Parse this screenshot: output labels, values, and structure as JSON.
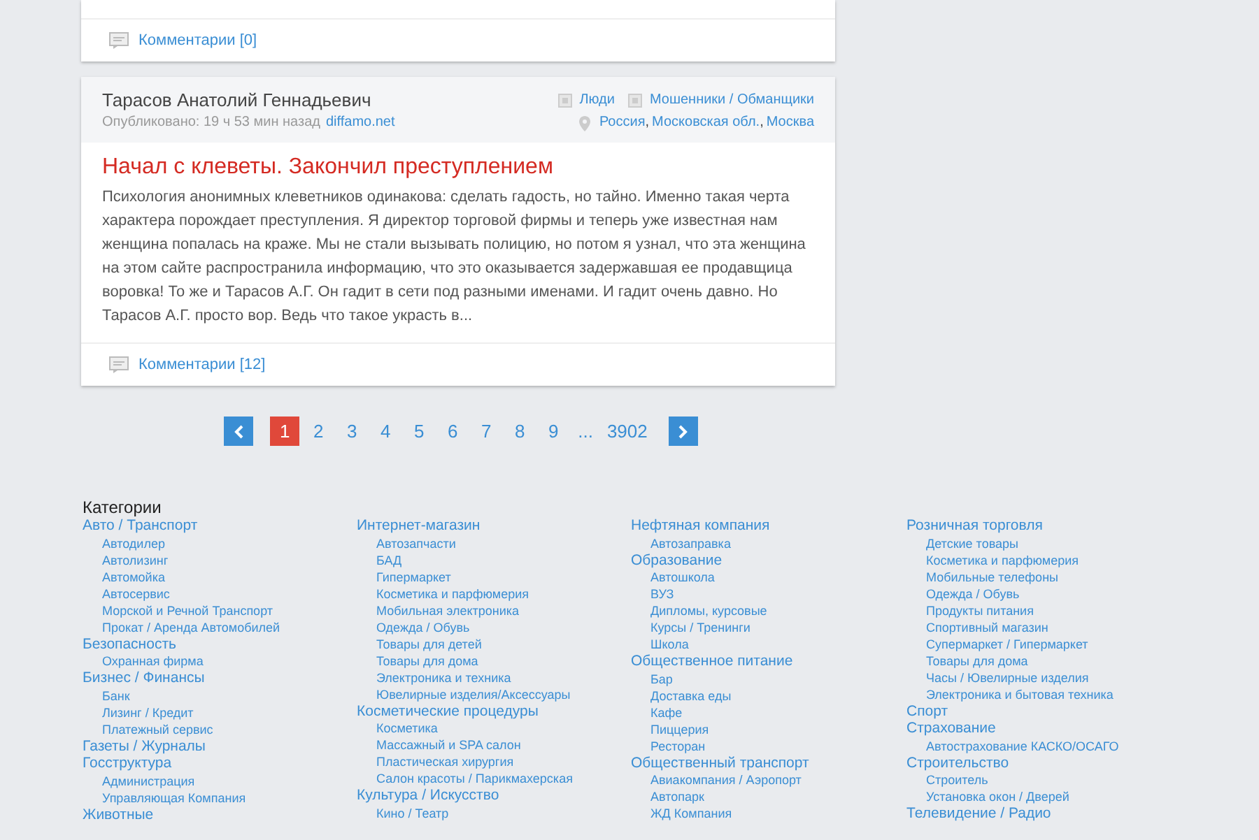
{
  "first_post": {
    "comments": "Комментарии [0]"
  },
  "post": {
    "author": "Тарасов Анатолий Геннадьевич",
    "published": "Опубликовано: 19 ч 53 мин назад",
    "source": "diffamo.net",
    "tags": [
      "Люди",
      "Мошенники / Обманщики"
    ],
    "location": [
      {
        "name": "Россия",
        "sep": ","
      },
      {
        "name": "Московская обл.",
        "sep": ","
      },
      {
        "name": "Москва"
      }
    ],
    "title": "Начал с клеветы. Закончил преступлением",
    "text": "Психология анонимных клеветников одинакова: сделать гадость, но тайно. Именно такая черта характера порождает преступления. Я директор торговой фирмы и теперь уже известная нам женщина попалась на краже. Мы не стали вызывать полицию, но потом я узнал, что эта женщина на этом сайте распространила информацию, что это оказывается задержавшая ее продавщица воровка! То же и Тарасов А.Г. Он гадит в сети под разными именами. И гадит очень давно. Но Тарасов А.Г. просто вор. Ведь что такое украсть в...",
    "comments": "Комментарии [12]"
  },
  "pagination": [
    {
      "kind": "page",
      "label": "1",
      "selected": true
    },
    {
      "kind": "page",
      "label": "2",
      "selected": false
    },
    {
      "kind": "page",
      "label": "3",
      "selected": false
    },
    {
      "kind": "page",
      "label": "4",
      "selected": false
    },
    {
      "kind": "page",
      "label": "5",
      "selected": false
    },
    {
      "kind": "page",
      "label": "6",
      "selected": false
    },
    {
      "kind": "page",
      "label": "7",
      "selected": false
    },
    {
      "kind": "page",
      "label": "8",
      "selected": false
    },
    {
      "kind": "page",
      "label": "9",
      "selected": false
    },
    {
      "kind": "ellipsis",
      "label": "..."
    },
    {
      "kind": "page",
      "label": "3902",
      "selected": false
    }
  ],
  "categories": {
    "title": "Категории",
    "columns": [
      [
        {
          "name": "Авто / Транспорт",
          "children": [
            {
              "name": "Автодилер"
            },
            {
              "name": "Автолизинг"
            },
            {
              "name": "Автомойка"
            },
            {
              "name": "Автосервис"
            },
            {
              "name": "Морской и Речной Транспорт"
            },
            {
              "name": "Прокат / Аренда Автомобилей"
            }
          ]
        },
        {
          "name": "Безопасность",
          "children": [
            {
              "name": "Охранная фирма"
            }
          ]
        },
        {
          "name": "Бизнес / Финансы",
          "children": [
            {
              "name": "Банк"
            },
            {
              "name": "Лизинг / Кредит"
            },
            {
              "name": "Платежный сервис"
            }
          ]
        },
        {
          "name": "Газеты / Журналы"
        },
        {
          "name": "Госструктура",
          "children": [
            {
              "name": "Администрация"
            },
            {
              "name": "Управляющая Компания"
            }
          ]
        },
        {
          "name": "Животные"
        }
      ],
      [
        {
          "name": "Интернет-магазин",
          "children": [
            {
              "name": "Автозапчасти"
            },
            {
              "name": "БАД"
            },
            {
              "name": "Гипермаркет"
            },
            {
              "name": "Косметика и парфюмерия"
            },
            {
              "name": "Мобильная электроника"
            },
            {
              "name": "Одежда / Обувь"
            },
            {
              "name": "Товары для детей"
            },
            {
              "name": "Товары для дома"
            },
            {
              "name": "Электроника и техника"
            },
            {
              "name": "Ювелирные изделия/Аксессуары"
            }
          ]
        },
        {
          "name": "Косметические процедуры",
          "children": [
            {
              "name": "Косметика"
            },
            {
              "name": "Массажный и SPA салон"
            },
            {
              "name": "Пластическая хирургия"
            },
            {
              "name": "Салон красоты / Парикмахерская"
            }
          ]
        },
        {
          "name": "Культура / Искусство",
          "children": [
            {
              "name": "Кино / Театр"
            }
          ]
        }
      ],
      [
        {
          "name": "Нефтяная компания",
          "children": [
            {
              "name": "Автозаправка"
            }
          ]
        },
        {
          "name": "Образование",
          "children": [
            {
              "name": "Автошкола"
            },
            {
              "name": "ВУЗ"
            },
            {
              "name": "Дипломы, курсовые"
            },
            {
              "name": "Курсы / Тренинги"
            },
            {
              "name": "Школа"
            }
          ]
        },
        {
          "name": "Общественное питание",
          "children": [
            {
              "name": "Бар"
            },
            {
              "name": "Доставка еды"
            },
            {
              "name": "Кафе"
            },
            {
              "name": "Пиццерия"
            },
            {
              "name": "Ресторан"
            }
          ]
        },
        {
          "name": "Общественный транспорт",
          "children": [
            {
              "name": "Авиакомпания / Аэропорт"
            },
            {
              "name": "Автопарк"
            },
            {
              "name": "ЖД Компания"
            }
          ]
        }
      ],
      [
        {
          "name": "Розничная торговля",
          "children": [
            {
              "name": "Детские товары"
            },
            {
              "name": "Косметика и парфюмерия"
            },
            {
              "name": "Мобильные телефоны"
            },
            {
              "name": "Одежда / Обувь"
            },
            {
              "name": "Продукты питания"
            },
            {
              "name": "Спортивный магазин"
            },
            {
              "name": "Супермаркет / Гипермаркет"
            },
            {
              "name": "Товары для дома"
            },
            {
              "name": "Часы / Ювелирные изделия"
            },
            {
              "name": "Электроника и бытовая техника"
            }
          ]
        },
        {
          "name": "Спорт"
        },
        {
          "name": "Страхование",
          "children": [
            {
              "name": "Автострахование КАСКО/ОСАГО"
            }
          ]
        },
        {
          "name": "Строительство",
          "children": [
            {
              "name": "Строитель"
            },
            {
              "name": "Установка окон / Дверей"
            }
          ]
        },
        {
          "name": "Телевидение / Радио"
        }
      ]
    ]
  }
}
